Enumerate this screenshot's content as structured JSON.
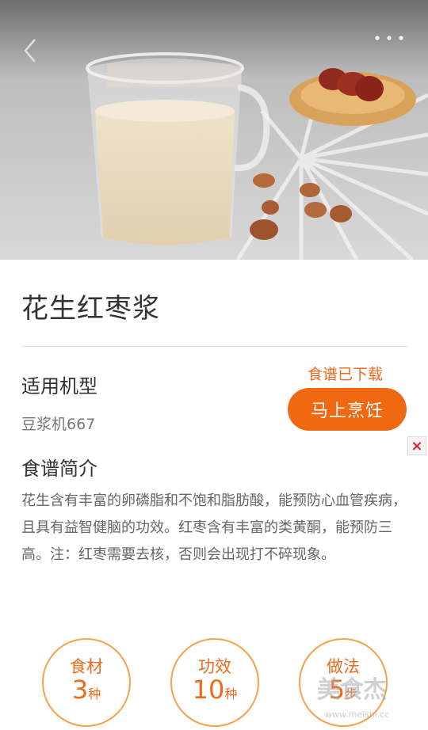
{
  "header": {
    "back_icon": "chevron-left-icon",
    "more_icon": "more-dots-icon"
  },
  "recipe": {
    "title": "花生红枣浆",
    "model_label": "适用机型",
    "model_value": "豆浆机667",
    "download_status": "食谱已下载",
    "cook_button": "马上烹饪",
    "intro_label": "食谱简介",
    "intro_text": "花生含有丰富的卵磷脂和不饱和脂肪酸，能预防心血管疾病，且具有益智健脑的功效。红枣含有丰富的类黄酮，能预防三高。注：红枣需要去核，否则会出现打不碎现象。"
  },
  "stats": [
    {
      "label": "食材",
      "value": "3",
      "unit": "种"
    },
    {
      "label": "功效",
      "value": "10",
      "unit": "种"
    },
    {
      "label": "做法",
      "value": "5",
      "unit": "步"
    }
  ],
  "ad_close": "×",
  "watermark": {
    "text": "美食杰",
    "url": "www.meishi.cc"
  },
  "colors": {
    "accent": "#f0680f",
    "circle_border": "#f5a24a"
  }
}
